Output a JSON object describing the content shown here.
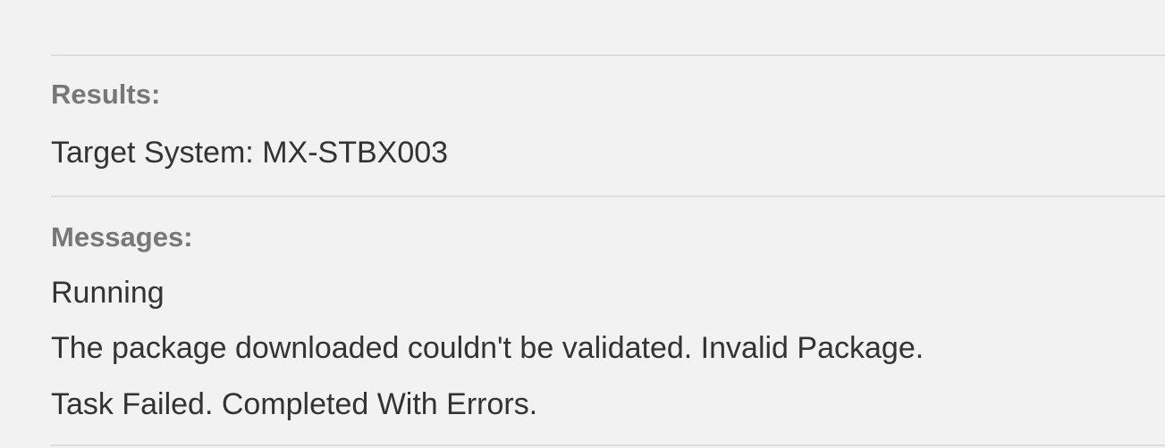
{
  "results": {
    "heading": "Results:",
    "target_system": "Target System: MX-STBX003"
  },
  "messages": {
    "heading": "Messages:",
    "items": [
      "Running",
      "The package downloaded couldn't be validated. Invalid Package.",
      "Task Failed. Completed With Errors."
    ]
  }
}
